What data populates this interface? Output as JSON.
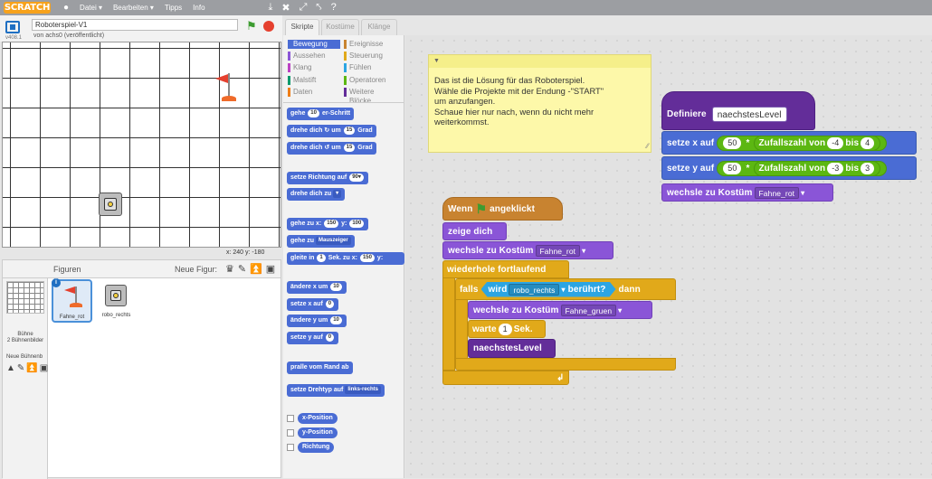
{
  "menubar": {
    "logo": "SCRATCH",
    "menus": [
      "Datei ▾",
      "Bearbeiten ▾",
      "Tipps",
      "Info"
    ],
    "icons": [
      "duplicate-icon",
      "delete-icon",
      "grow-icon",
      "shrink-icon",
      "help-icon"
    ]
  },
  "stage_header": {
    "project_title": "Roboterspiel-V1",
    "author": "von achs0 (veröffentlicht)",
    "version": "v408.1"
  },
  "stage": {
    "coords": "x: 240  y: -180"
  },
  "sprites": {
    "figuren": "Figuren",
    "neue_figur": "Neue Figur:",
    "stage_name": "Bühne",
    "stage_count": "2 Bühnenbilder",
    "neue_buehne": "Neue Bühnenb",
    "items": [
      {
        "name": "Fahne_rot",
        "selected": true
      },
      {
        "name": "robo_rechts",
        "selected": false
      }
    ]
  },
  "tabs": {
    "skripte": "Skripte",
    "kostueme": "Kostüme",
    "klaenge": "Klänge"
  },
  "categories": [
    {
      "label": "Bewegung",
      "color": "#4a6cd4",
      "active": true
    },
    {
      "label": "Ereignisse",
      "color": "#c88330"
    },
    {
      "label": "Aussehen",
      "color": "#8a55d7"
    },
    {
      "label": "Steuerung",
      "color": "#e1a91a"
    },
    {
      "label": "Klang",
      "color": "#bb42c3"
    },
    {
      "label": "Fühlen",
      "color": "#2ca5e2"
    },
    {
      "label": "Malstift",
      "color": "#0e9a6c"
    },
    {
      "label": "Operatoren",
      "color": "#5cb712"
    },
    {
      "label": "Daten",
      "color": "#ee7d16"
    },
    {
      "label": "Weitere Blöcke",
      "color": "#632d99"
    }
  ],
  "palette": {
    "gehe": "gehe",
    "gehe_val": "10",
    "gehe_suffix": "er-Schritt",
    "drehe_r": "drehe dich",
    "drehe_l": "drehe dich",
    "um": "um",
    "grad": "Grad",
    "drehe_val": "15",
    "setze_richtung": "setze Richtung auf",
    "richtung_val": "90▾",
    "drehe_zu": "drehe dich zu",
    "gehe_zu_xy": "gehe zu x:",
    "xy_x": "150",
    "xy_y_label": "y:",
    "xy_y": "100",
    "gehe_zu": "gehe zu",
    "mauszeiger": "Mauszeiger",
    "gleite": "gleite in",
    "gleite_val": "1",
    "gleite_mid": "Sek. zu x:",
    "gleite_x": "150",
    "gleite_y_label": "y:",
    "aendere_x": "ändere x um",
    "aendere_x_val": "10",
    "setze_x": "setze x auf",
    "setze_x_val": "0",
    "aendere_y": "ändere y um",
    "aendere_y_val": "10",
    "setze_y": "setze y auf",
    "setze_y_val": "0",
    "pralle": "pralle vom Rand ab",
    "drehtyp": "setze Drehtyp auf",
    "drehtyp_val": "links-rechts",
    "x_position": "x-Position",
    "y_position": "y-Position",
    "richtung": "Richtung"
  },
  "note": {
    "text": "Das ist die Lösung für das Roboterspiel.\nWähle die Projekte mit der Endung -\"START\"\num anzufangen.\nSchaue hier nur nach, wenn du nicht mehr\nweiterkommst."
  },
  "script1": {
    "wenn": "Wenn",
    "angeklickt": "angeklickt",
    "zeige_dich": "zeige dich",
    "wechsle_kostuem": "wechsle zu Kostüm",
    "kostuem1": "Fahne_rot",
    "wiederhole": "wiederhole fortlaufend",
    "falls": "falls",
    "wird": "wird",
    "sprite": "robo_rechts",
    "beruehrt": "berührt?",
    "dann": "dann",
    "kostuem2": "Fahne_gruen",
    "warte": "warte",
    "warte_val": "1",
    "sek": "Sek.",
    "naechstes": "naechstesLevel",
    "loop_arrow": "↲"
  },
  "script2": {
    "definiere": "Definiere",
    "level_name": "naechstesLevel",
    "setze_x": "setze x auf",
    "setze_y": "setze y auf",
    "factor": "50",
    "times": "*",
    "zufall": "Zufallszahl von",
    "bis": "bis",
    "x_from": "-4",
    "x_to": "4",
    "y_from": "-3",
    "y_to": "3",
    "wechsle_kostuem": "wechsle zu Kostüm",
    "kostuem": "Fahne_rot"
  }
}
